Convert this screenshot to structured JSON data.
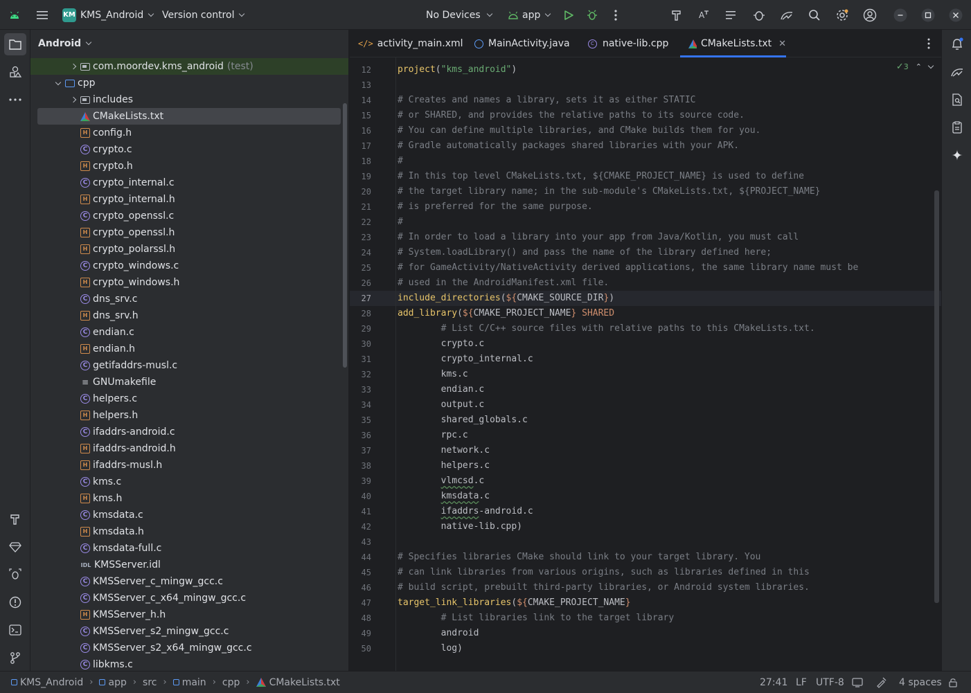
{
  "titlebar": {
    "project_badge": "KM",
    "project_name": "KMS_Android",
    "vcs_label": "Version control",
    "devices_label": "No Devices",
    "run_config": "app"
  },
  "project_panel": {
    "view_label": "Android",
    "items": [
      {
        "label": "com.moordev.kms_android",
        "hint": "(test)",
        "icon": "package-folder-icon"
      },
      {
        "label": "cpp",
        "icon": "folder-icon"
      },
      {
        "label": "includes",
        "icon": "package-folder-icon"
      },
      {
        "label": "CMakeLists.txt",
        "icon": "cmake-icon"
      },
      {
        "label": "config.h",
        "icon": "header-file-icon"
      },
      {
        "label": "crypto.c",
        "icon": "c-file-icon"
      },
      {
        "label": "crypto.h",
        "icon": "header-file-icon"
      },
      {
        "label": "crypto_internal.c",
        "icon": "c-file-icon"
      },
      {
        "label": "crypto_internal.h",
        "icon": "header-file-icon"
      },
      {
        "label": "crypto_openssl.c",
        "icon": "c-file-icon"
      },
      {
        "label": "crypto_openssl.h",
        "icon": "header-file-icon"
      },
      {
        "label": "crypto_polarssl.h",
        "icon": "header-file-icon"
      },
      {
        "label": "crypto_windows.c",
        "icon": "c-file-icon"
      },
      {
        "label": "crypto_windows.h",
        "icon": "header-file-icon"
      },
      {
        "label": "dns_srv.c",
        "icon": "c-file-icon"
      },
      {
        "label": "dns_srv.h",
        "icon": "header-file-icon"
      },
      {
        "label": "endian.c",
        "icon": "c-file-icon"
      },
      {
        "label": "endian.h",
        "icon": "header-file-icon"
      },
      {
        "label": "getifaddrs-musl.c",
        "icon": "c-file-icon"
      },
      {
        "label": "GNUmakefile",
        "icon": "makefile-icon"
      },
      {
        "label": "helpers.c",
        "icon": "c-file-icon"
      },
      {
        "label": "helpers.h",
        "icon": "header-file-icon"
      },
      {
        "label": "ifaddrs-android.c",
        "icon": "c-file-icon"
      },
      {
        "label": "ifaddrs-android.h",
        "icon": "header-file-icon"
      },
      {
        "label": "ifaddrs-musl.h",
        "icon": "header-file-icon"
      },
      {
        "label": "kms.c",
        "icon": "c-file-icon"
      },
      {
        "label": "kms.h",
        "icon": "header-file-icon"
      },
      {
        "label": "kmsdata.c",
        "icon": "c-file-icon"
      },
      {
        "label": "kmsdata.h",
        "icon": "header-file-icon"
      },
      {
        "label": "kmsdata-full.c",
        "icon": "c-file-icon"
      },
      {
        "label": "KMSServer.idl",
        "icon": "idl-file-icon"
      },
      {
        "label": "KMSServer_c_mingw_gcc.c",
        "icon": "c-file-icon"
      },
      {
        "label": "KMSServer_c_x64_mingw_gcc.c",
        "icon": "c-file-icon"
      },
      {
        "label": "KMSServer_h.h",
        "icon": "header-file-icon"
      },
      {
        "label": "KMSServer_s2_mingw_gcc.c",
        "icon": "c-file-icon"
      },
      {
        "label": "KMSServer_s2_x64_mingw_gcc.c",
        "icon": "c-file-icon"
      },
      {
        "label": "libkms.c",
        "icon": "c-file-icon"
      }
    ]
  },
  "tabs": [
    {
      "label": "activity_main.xml",
      "icon": "xml-icon"
    },
    {
      "label": "MainActivity.java",
      "icon": "java-class-icon"
    },
    {
      "label": "native-lib.cpp",
      "icon": "cpp-file-icon"
    },
    {
      "label": "CMakeLists.txt",
      "icon": "cmake-icon",
      "active": true
    }
  ],
  "editor": {
    "inspection_count": "3",
    "current_line": 27,
    "lines": [
      {
        "n": "12",
        "parts": [
          [
            "fn",
            "project"
          ],
          [
            "pl",
            "("
          ],
          [
            "str",
            "\"kms_android\""
          ],
          [
            "pl",
            ")"
          ]
        ]
      },
      {
        "n": "13",
        "parts": []
      },
      {
        "n": "14",
        "parts": [
          [
            "cm",
            "# Creates and names a library, sets it as either STATIC"
          ]
        ]
      },
      {
        "n": "15",
        "parts": [
          [
            "cm",
            "# or SHARED, and provides the relative paths to its source code."
          ]
        ]
      },
      {
        "n": "16",
        "parts": [
          [
            "cm",
            "# You can define multiple libraries, and CMake builds them for you."
          ]
        ]
      },
      {
        "n": "17",
        "parts": [
          [
            "cm",
            "# Gradle automatically packages shared libraries with your APK."
          ]
        ]
      },
      {
        "n": "18",
        "parts": [
          [
            "cm",
            "#"
          ]
        ]
      },
      {
        "n": "19",
        "parts": [
          [
            "cm",
            "# In this top level CMakeLists.txt, ${CMAKE_PROJECT_NAME} is used to define"
          ]
        ]
      },
      {
        "n": "20",
        "parts": [
          [
            "cm",
            "# the target library name; in the sub-module's CMakeLists.txt, ${PROJECT_NAME}"
          ]
        ]
      },
      {
        "n": "21",
        "parts": [
          [
            "cm",
            "# is preferred for the same purpose."
          ]
        ]
      },
      {
        "n": "22",
        "parts": [
          [
            "cm",
            "#"
          ]
        ]
      },
      {
        "n": "23",
        "parts": [
          [
            "cm",
            "# In order to load a library into your app from Java/Kotlin, you must call"
          ]
        ]
      },
      {
        "n": "24",
        "parts": [
          [
            "cm",
            "# System.loadLibrary() and pass the name of the library defined here;"
          ]
        ]
      },
      {
        "n": "25",
        "parts": [
          [
            "cm",
            "# for GameActivity/NativeActivity derived applications, the same library name must be"
          ]
        ]
      },
      {
        "n": "26",
        "parts": [
          [
            "cm",
            "# used in the AndroidManifest.xml file."
          ]
        ]
      },
      {
        "n": "27",
        "parts": [
          [
            "fn",
            "include_directories"
          ],
          [
            "pl",
            "("
          ],
          [
            "kw",
            "${"
          ],
          [
            "ident",
            "CMAKE_SOURCE_DIR"
          ],
          [
            "kw",
            "}"
          ],
          [
            "pl",
            ")"
          ]
        ]
      },
      {
        "n": "28",
        "parts": [
          [
            "fn",
            "add_library"
          ],
          [
            "pl",
            "("
          ],
          [
            "kw",
            "${"
          ],
          [
            "ident",
            "CMAKE_PROJECT_NAME"
          ],
          [
            "kw",
            "}"
          ],
          [
            "pl",
            " "
          ],
          [
            "kw",
            "SHARED"
          ]
        ]
      },
      {
        "n": "29",
        "parts": [
          [
            "pl",
            "        "
          ],
          [
            "cm",
            "# List C/C++ source files with relative paths to this CMakeLists.txt."
          ]
        ]
      },
      {
        "n": "30",
        "parts": [
          [
            "pl",
            "        crypto.c"
          ]
        ]
      },
      {
        "n": "31",
        "parts": [
          [
            "pl",
            "        crypto_internal.c"
          ]
        ]
      },
      {
        "n": "32",
        "parts": [
          [
            "pl",
            "        kms.c"
          ]
        ]
      },
      {
        "n": "33",
        "parts": [
          [
            "pl",
            "        endian.c"
          ]
        ]
      },
      {
        "n": "34",
        "parts": [
          [
            "pl",
            "        output.c"
          ]
        ]
      },
      {
        "n": "35",
        "parts": [
          [
            "pl",
            "        shared_globals.c"
          ]
        ]
      },
      {
        "n": "36",
        "parts": [
          [
            "pl",
            "        rpc.c"
          ]
        ]
      },
      {
        "n": "37",
        "parts": [
          [
            "pl",
            "        network.c"
          ]
        ]
      },
      {
        "n": "38",
        "parts": [
          [
            "pl",
            "        helpers.c"
          ]
        ]
      },
      {
        "n": "39",
        "parts": [
          [
            "pl",
            "        "
          ],
          [
            "typo",
            "vlmcsd"
          ],
          [
            "pl",
            ".c"
          ]
        ]
      },
      {
        "n": "40",
        "parts": [
          [
            "pl",
            "        "
          ],
          [
            "typo",
            "kmsdata"
          ],
          [
            "pl",
            ".c"
          ]
        ]
      },
      {
        "n": "41",
        "parts": [
          [
            "pl",
            "        "
          ],
          [
            "typo",
            "ifaddrs"
          ],
          [
            "pl",
            "-android.c"
          ]
        ]
      },
      {
        "n": "42",
        "parts": [
          [
            "pl",
            "        native-lib.cpp)"
          ]
        ]
      },
      {
        "n": "43",
        "parts": []
      },
      {
        "n": "44",
        "parts": [
          [
            "cm",
            "# Specifies libraries CMake should link to your target library. You"
          ]
        ]
      },
      {
        "n": "45",
        "parts": [
          [
            "cm",
            "# can link libraries from various origins, such as libraries defined in this"
          ]
        ]
      },
      {
        "n": "46",
        "parts": [
          [
            "cm",
            "# build script, prebuilt third-party libraries, or Android system libraries."
          ]
        ]
      },
      {
        "n": "47",
        "parts": [
          [
            "fn",
            "target_link_libraries"
          ],
          [
            "pl",
            "("
          ],
          [
            "kw",
            "${"
          ],
          [
            "ident",
            "CMAKE_PROJECT_NAME"
          ],
          [
            "kw",
            "}"
          ]
        ]
      },
      {
        "n": "48",
        "parts": [
          [
            "pl",
            "        "
          ],
          [
            "cm",
            "# List libraries link to the target library"
          ]
        ]
      },
      {
        "n": "49",
        "parts": [
          [
            "pl",
            "        android"
          ]
        ]
      },
      {
        "n": "50",
        "parts": [
          [
            "pl",
            "        log)"
          ]
        ]
      }
    ]
  },
  "statusbar": {
    "breadcrumbs": [
      {
        "label": "KMS_Android",
        "icon": "module-icon"
      },
      {
        "label": "app",
        "icon": "module-icon"
      },
      {
        "label": "src",
        "icon": ""
      },
      {
        "label": "main",
        "icon": "module-icon"
      },
      {
        "label": "cpp",
        "icon": ""
      },
      {
        "label": "CMakeLists.txt",
        "icon": "cmake-icon"
      }
    ],
    "position": "27:41",
    "line_sep": "LF",
    "encoding": "UTF-8",
    "indent": "4 spaces"
  },
  "colors": {
    "accent": "#3574f0",
    "run_green": "#5fb865",
    "comment": "#7a7e85",
    "function": "#e8c56a",
    "string": "#6aab73",
    "keyword": "#cf8e6d"
  }
}
